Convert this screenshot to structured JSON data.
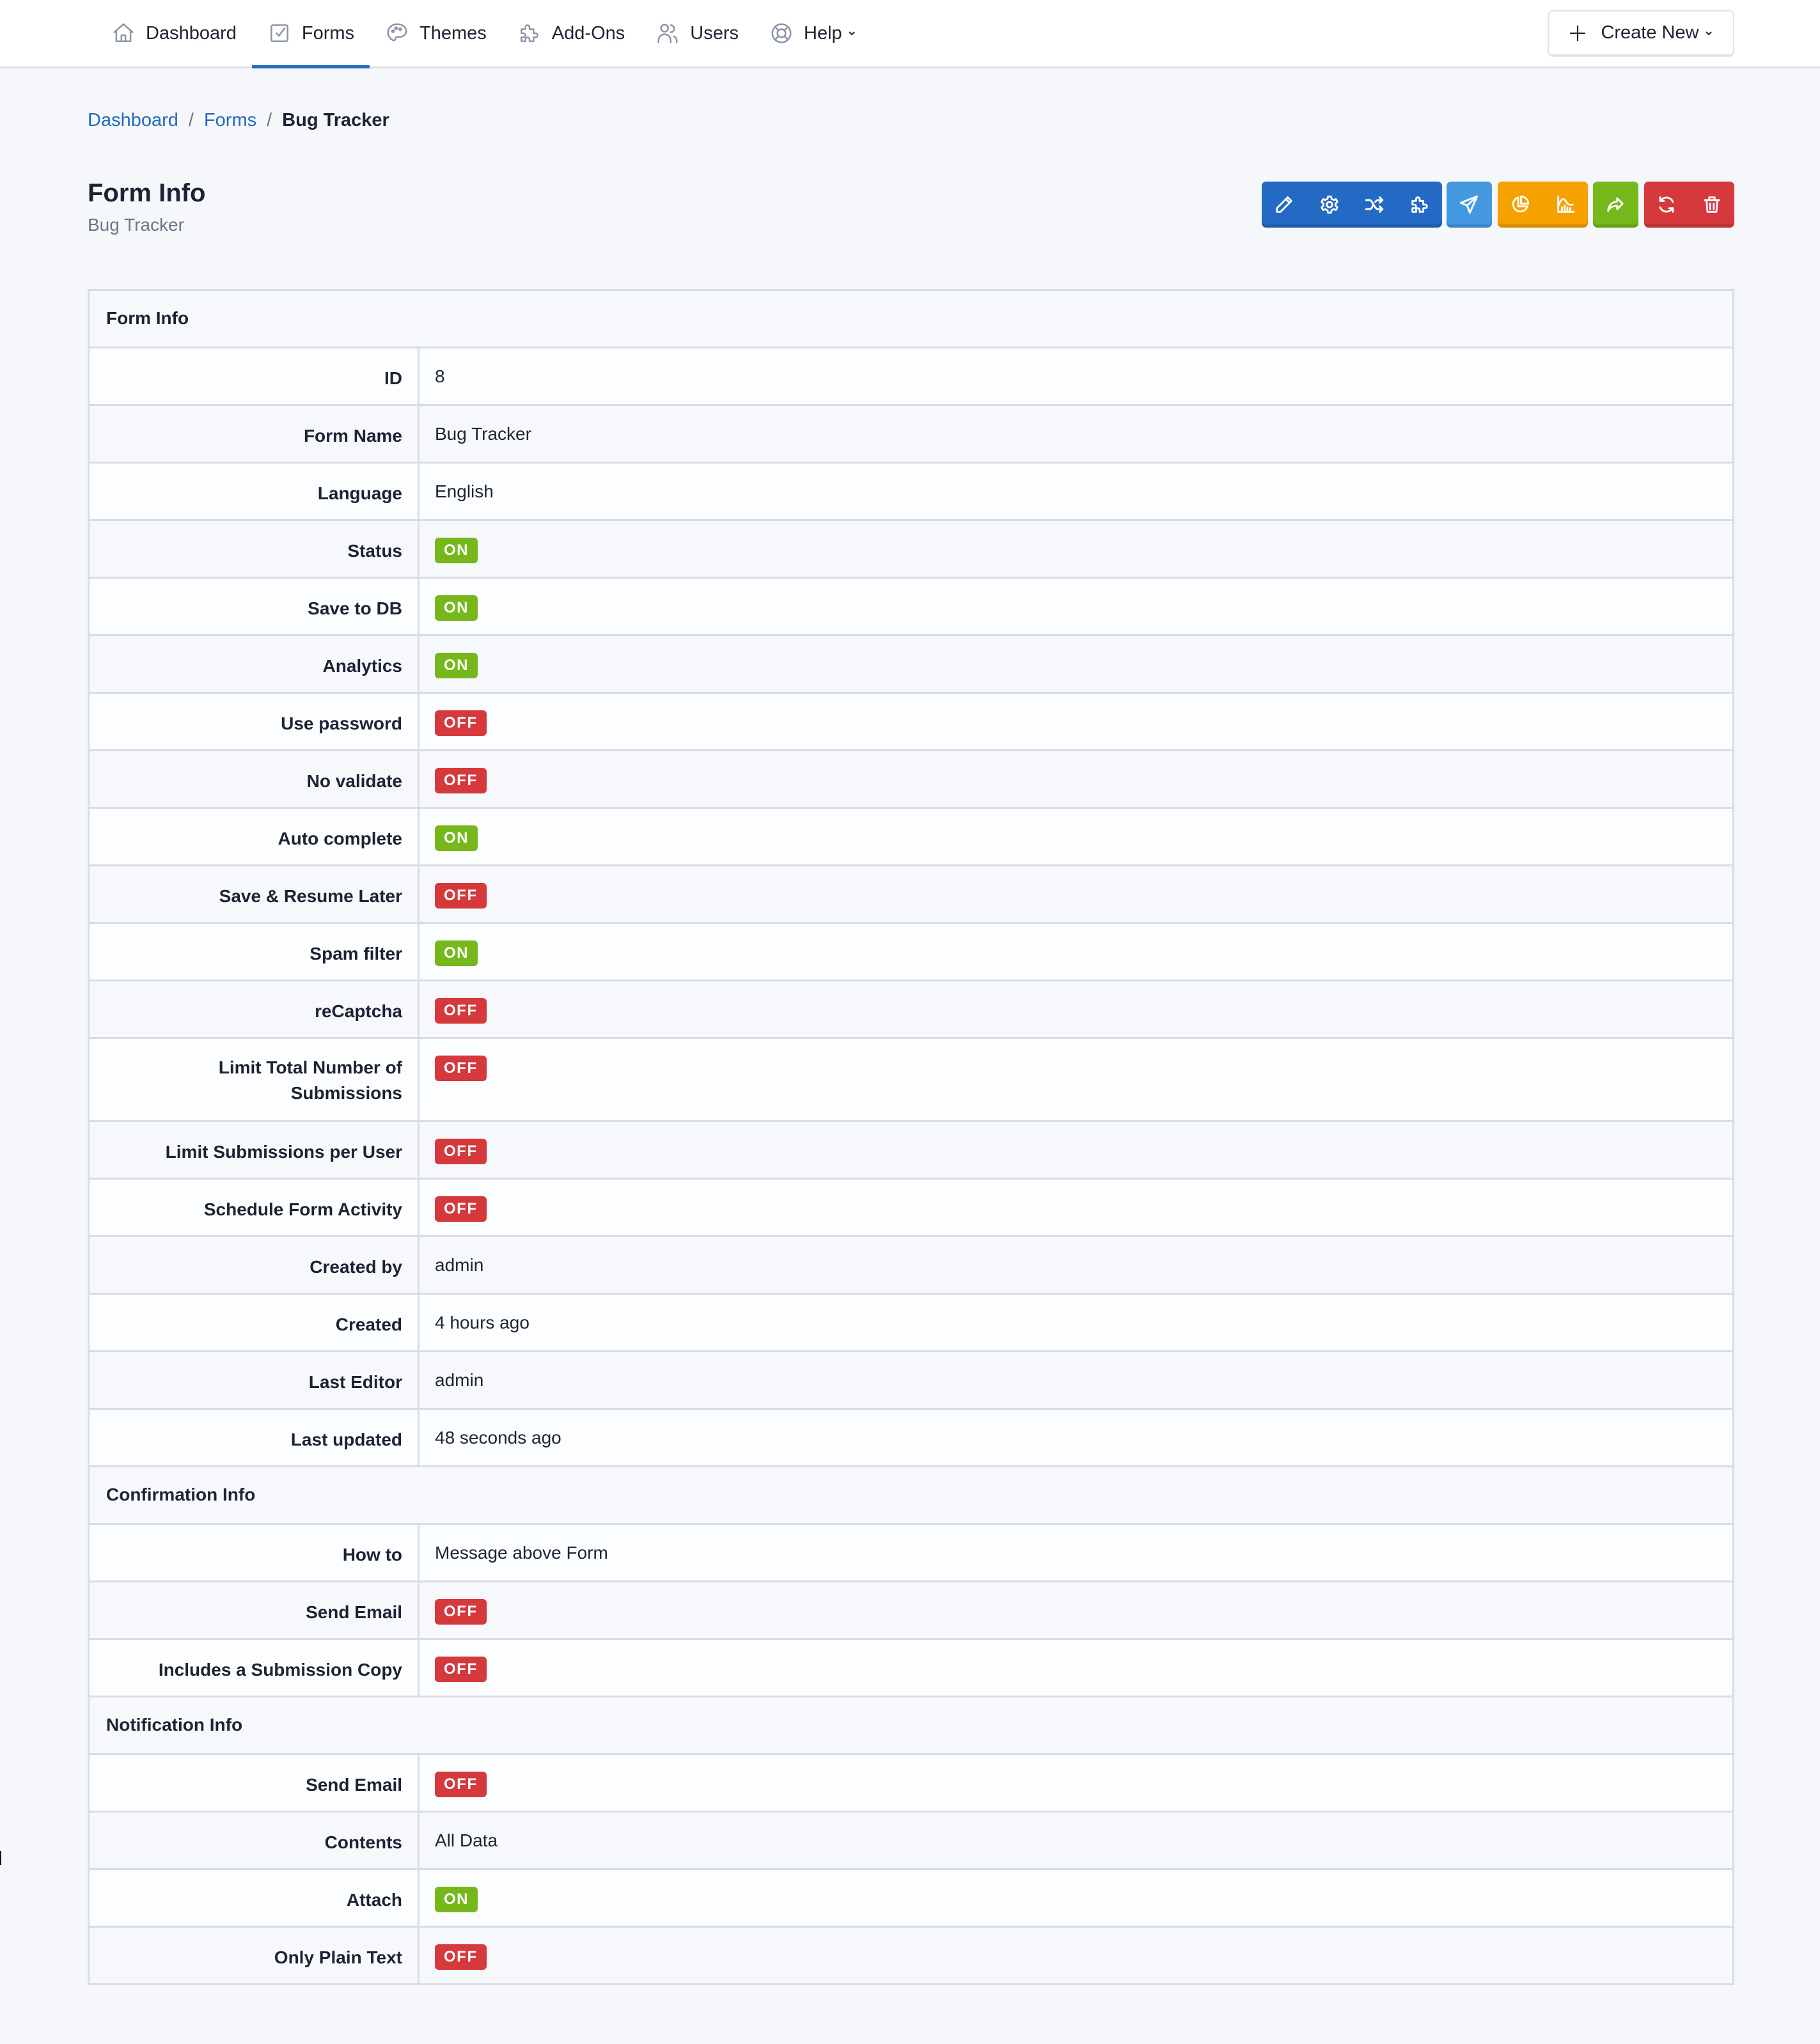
{
  "nav": {
    "items": [
      {
        "label": "Dashboard",
        "icon": "home-icon",
        "active": false
      },
      {
        "label": "Forms",
        "icon": "checkbox-icon",
        "active": true
      },
      {
        "label": "Themes",
        "icon": "palette-icon",
        "active": false
      },
      {
        "label": "Add-Ons",
        "icon": "puzzle-icon",
        "active": false
      },
      {
        "label": "Users",
        "icon": "users-icon",
        "active": false
      },
      {
        "label": "Help",
        "icon": "lifebuoy-icon",
        "active": false,
        "dropdown": true
      }
    ],
    "create_new_label": "Create New"
  },
  "breadcrumb": {
    "items": [
      "Dashboard",
      "Forms"
    ],
    "separator": "/",
    "current": "Bug Tracker"
  },
  "page": {
    "title": "Form Info",
    "subtitle": "Bug Tracker"
  },
  "toolbar": {
    "groups": [
      {
        "color": "#236ac4",
        "buttons": [
          "edit-icon",
          "settings-icon",
          "shuffle-icon",
          "puzzle-icon"
        ]
      },
      {
        "color": "#4599e0",
        "buttons": [
          "send-icon"
        ]
      },
      {
        "color": "#f5a100",
        "buttons": [
          "pie-chart-icon",
          "area-chart-icon"
        ]
      },
      {
        "color": "#76b81b",
        "buttons": [
          "share-icon"
        ]
      },
      {
        "color": "#d5393c",
        "buttons": [
          "refresh-icon",
          "trash-icon"
        ]
      }
    ]
  },
  "colors": {
    "on": "#76b81b",
    "off": "#d5393c",
    "link": "#2369c3"
  },
  "table": {
    "sections": [
      {
        "title": "Form Info",
        "rows": [
          {
            "label": "ID",
            "value": "8"
          },
          {
            "label": "Form Name",
            "value": "Bug Tracker"
          },
          {
            "label": "Language",
            "value": "English"
          },
          {
            "label": "Status",
            "badge": "ON"
          },
          {
            "label": "Save to DB",
            "badge": "ON"
          },
          {
            "label": "Analytics",
            "badge": "ON"
          },
          {
            "label": "Use password",
            "badge": "OFF"
          },
          {
            "label": "No validate",
            "badge": "OFF"
          },
          {
            "label": "Auto complete",
            "badge": "ON"
          },
          {
            "label": "Save & Resume Later",
            "badge": "OFF"
          },
          {
            "label": "Spam filter",
            "badge": "ON"
          },
          {
            "label": "reCaptcha",
            "badge": "OFF"
          },
          {
            "label": "Limit Total Number of Submissions",
            "badge": "OFF"
          },
          {
            "label": "Limit Submissions per User",
            "badge": "OFF"
          },
          {
            "label": "Schedule Form Activity",
            "badge": "OFF"
          },
          {
            "label": "Created by",
            "value": "admin"
          },
          {
            "label": "Created",
            "value": "4 hours ago"
          },
          {
            "label": "Last Editor",
            "value": "admin"
          },
          {
            "label": "Last updated",
            "value": "48 seconds ago"
          }
        ]
      },
      {
        "title": "Confirmation Info",
        "rows": [
          {
            "label": "How to",
            "value": "Message above Form"
          },
          {
            "label": "Send Email",
            "badge": "OFF"
          },
          {
            "label": "Includes a Submission Copy",
            "badge": "OFF"
          }
        ]
      },
      {
        "title": "Notification Info",
        "rows": [
          {
            "label": "Send Email",
            "badge": "OFF"
          },
          {
            "label": "Contents",
            "value": "All Data"
          },
          {
            "label": "Attach",
            "badge": "ON"
          },
          {
            "label": "Only Plain Text",
            "badge": "OFF"
          }
        ]
      }
    ]
  }
}
